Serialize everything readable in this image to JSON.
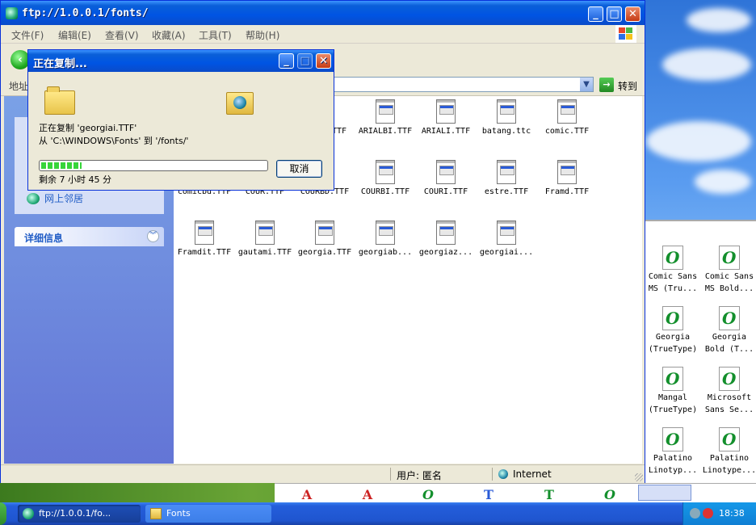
{
  "window": {
    "title": "ftp://1.0.0.1/fonts/",
    "minimize_glyph": "_",
    "maximize_glyph": "□",
    "close_glyph": "✕"
  },
  "menu": [
    "文件(F)",
    "编辑(E)",
    "查看(V)",
    "收藏(A)",
    "工具(T)",
    "帮助(H)"
  ],
  "address": {
    "label": "地址",
    "go_label": "转到"
  },
  "left_pane": {
    "network_link": "网上邻居",
    "details_header": "详细信息"
  },
  "files": [
    "TTF",
    "ARIALBI.TTF",
    "ARIALI.TTF",
    "batang.ttc",
    "comic.TTF",
    "comicbd.TTF",
    "COUR.TTF",
    "COURBD.TTF",
    "COURBI.TTF",
    "COURI.TTF",
    "estre.TTF",
    "Framd.TTF",
    "Framdit.TTF",
    "gautami.TTF",
    "georgia.TTF",
    "georgiab...",
    "georgiaz...",
    "georgiai..."
  ],
  "status": {
    "user": "用户: 匿名",
    "zone": "Internet"
  },
  "dialog": {
    "title": "正在复制...",
    "line1": "正在复制 'georgiai.TTF'",
    "line2": "从 'C:\\WINDOWS\\Fonts' 到 '/fonts/'",
    "remaining": "剩余 7 小时 45 分",
    "cancel": "取消",
    "progress_fraction": 0.18
  },
  "desktop_fonts": [
    {
      "glyph": "O",
      "label1": "Comic Sans",
      "label2": "MS (Tru..."
    },
    {
      "glyph": "O",
      "label1": "Comic Sans",
      "label2": "MS Bold..."
    },
    {
      "glyph": "O",
      "label1": "Georgia",
      "label2": "(TrueType)"
    },
    {
      "glyph": "O",
      "label1": "Georgia",
      "label2": "Bold (T..."
    },
    {
      "glyph": "O",
      "label1": "Mangal",
      "label2": "(TrueType)"
    },
    {
      "glyph": "O",
      "label1": "Microsoft",
      "label2": "Sans Se..."
    },
    {
      "glyph": "O",
      "label1": "Palatino",
      "label2": "Linotyp..."
    },
    {
      "glyph": "O",
      "label1": "Palatino",
      "label2": "Linotype..."
    }
  ],
  "taskbar": {
    "items": [
      {
        "label": "ftp://1.0.0.1/fo...",
        "icon": "ftp-globe-icon"
      },
      {
        "label": "Fonts",
        "icon": "folder-icon"
      }
    ],
    "clock": "18:38"
  }
}
